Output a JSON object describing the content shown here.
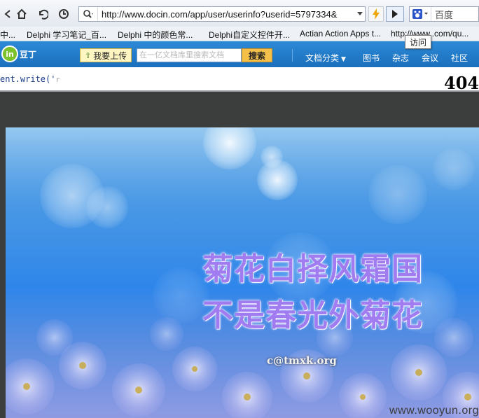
{
  "browser": {
    "address_url": "http://www.docin.com/app/user/userinfo?userid=5797334&",
    "search_placeholder": "百度",
    "go_tooltip": "访问"
  },
  "bookmarks": [
    {
      "label": "中..."
    },
    {
      "label": "Delphi 学习笔记_百..."
    },
    {
      "label": "Delphi 中的颜色常..."
    },
    {
      "label": "Delphi自定义控件开..."
    },
    {
      "label": "Actian Action Apps t..."
    },
    {
      "label": "http://www..com/qu..."
    }
  ],
  "site": {
    "logo_text": "豆丁",
    "upload_label": "我要上传",
    "search_placeholder": "在一亿文档库里搜索文档",
    "search_button": "搜索",
    "nav": [
      {
        "label": "文档分类"
      },
      {
        "label": "图书"
      },
      {
        "label": "杂志"
      },
      {
        "label": "会议"
      },
      {
        "label": "社区"
      }
    ]
  },
  "document": {
    "code_text": "ent.write('",
    "code_tail": "r",
    "error_code": "404"
  },
  "slide": {
    "line1": "菊花白择风霜国",
    "line2": "不是春光外菊花",
    "signature": "c@tmxk.org"
  },
  "watermark": "www.wooyun.org"
}
